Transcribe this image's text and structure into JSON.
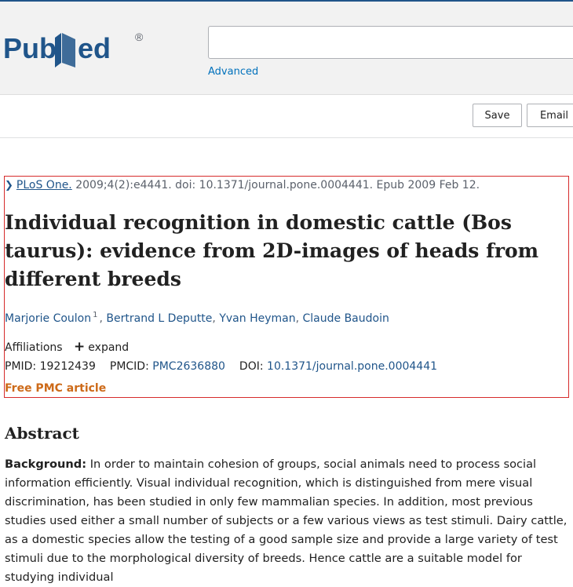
{
  "header": {
    "logo_text": "PubMed",
    "logo_mark": "®",
    "search_value": "",
    "advanced_label": "Advanced"
  },
  "toolbar": {
    "save_label": "Save",
    "email_label": "Email"
  },
  "article": {
    "journal": "PLoS One.",
    "citation_rest": " 2009;4(2):e4441. doi: 10.1371/journal.pone.0004441. Epub 2009 Feb 12.",
    "title": "Individual recognition in domestic cattle (Bos taurus): evidence from 2D-images of heads from different breeds",
    "authors": [
      "Marjorie Coulon",
      "Bertrand L Deputte",
      "Yvan Heyman",
      "Claude Baudoin"
    ],
    "author_sup": "1",
    "author_sep": ", ",
    "affiliations_label": "Affiliations",
    "expand_label": "expand",
    "pmid_label": "PMID:",
    "pmid_value": "19212439",
    "pmcid_label": "PMCID:",
    "pmcid_value": "PMC2636880",
    "doi_label": "DOI:",
    "doi_value": "10.1371/journal.pone.0004441",
    "free_pmc": "Free PMC article"
  },
  "abstract": {
    "heading": "Abstract",
    "lead": "Background:",
    "text": " In order to maintain cohesion of groups, social animals need to process social information efficiently. Visual individual recognition, which is distinguished from mere visual discrimination, has been studied in only few mammalian species. In addition, most previous studies used either a small number of subjects or a few various views as test stimuli. Dairy cattle, as a domestic species allow the testing of a good sample size and provide a large variety of test stimuli due to the morphological diversity of breeds. Hence cattle are a suitable model for studying individual"
  },
  "colors": {
    "brand_blue": "#20558a",
    "link_blue": "#0071bc",
    "highlight_red": "#d62b2b",
    "free_orange": "#cd6a19"
  },
  "icons": [
    "pubmed-logo-icon",
    "chevron-right-icon",
    "plus-icon"
  ]
}
